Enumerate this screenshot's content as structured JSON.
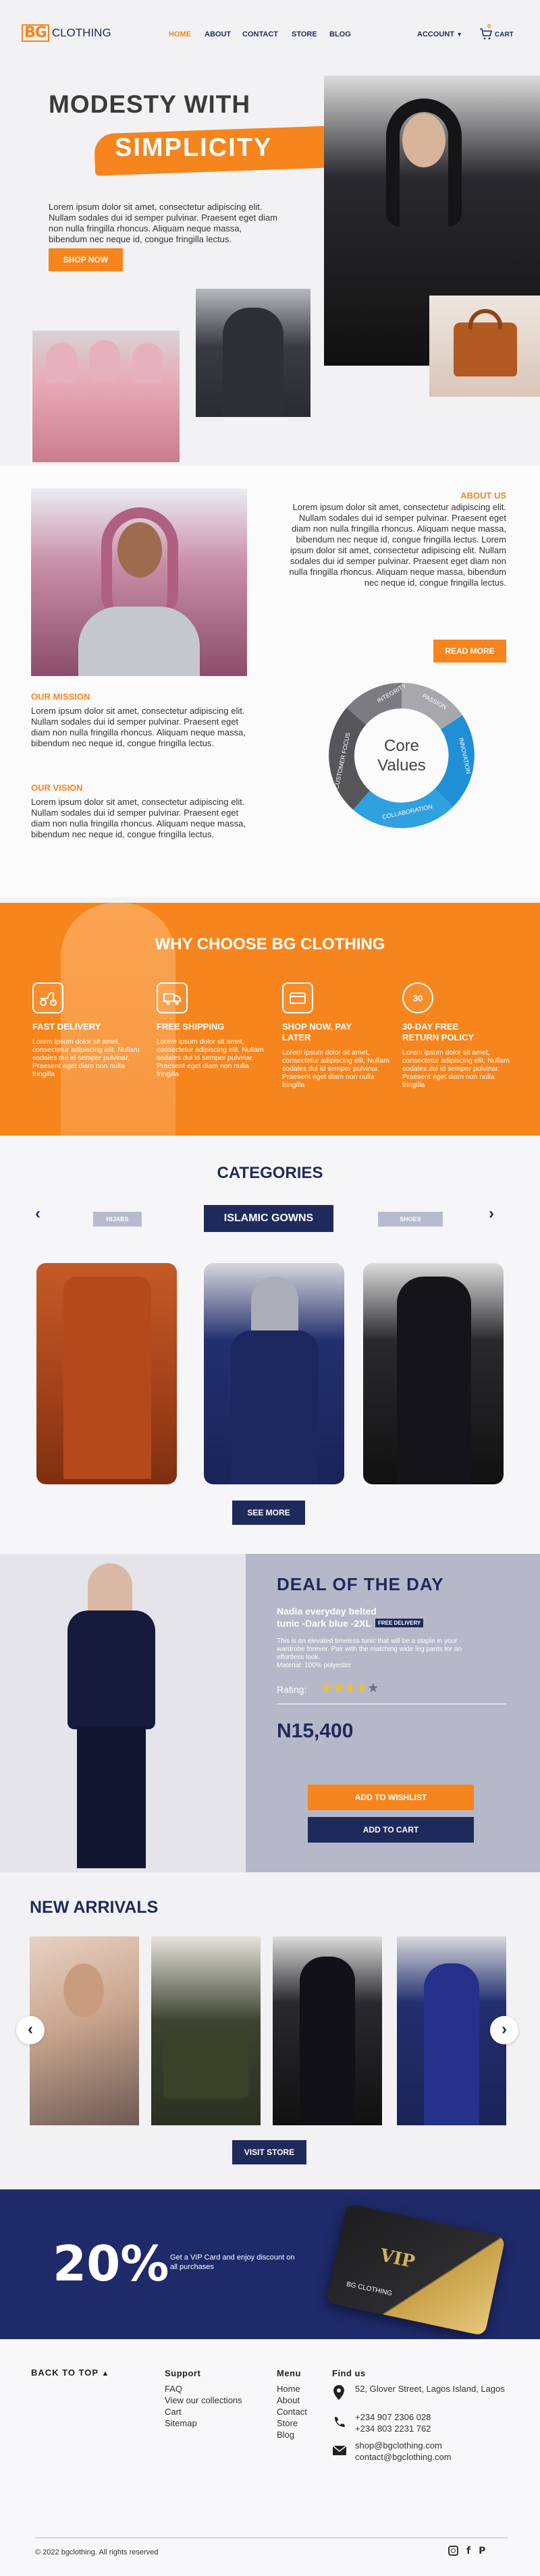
{
  "header": {
    "logo_mark": "BG",
    "logo_text": "CLOTHING",
    "nav": [
      "HOME",
      "ABOUT",
      "CONTACT",
      "STORE",
      "BLOG"
    ],
    "account": "ACCOUNT",
    "cart_count": "0",
    "cart_label": "CART",
    "colors": {
      "accent": "#f7851d",
      "brand": "#1f2a5c"
    }
  },
  "hero": {
    "title_line1": "MODESTY WITH",
    "title_line2": "SIMPLICITY",
    "text": "Lorem ipsum dolor sit amet, consectetur adipiscing elit. Nullam sodales dui id semper pulvinar. Praesent eget diam non nulla fringilla rhoncus. Aliquam neque massa, bibendum nec neque id, congue fringilla lectus.",
    "cta": "SHOP NOW"
  },
  "about": {
    "heading": "ABOUT US",
    "text": "Lorem ipsum dolor sit amet, consectetur adipiscing elit. Nullam sodales dui id semper pulvinar. Praesent eget diam non nulla fringilla rhoncus. Aliquam neque massa, bibendum nec neque id, congue fringilla lectus. Lorem ipsum dolor sit amet, consectetur adipiscing elit. Nullam sodales dui id semper pulvinar. Praesent eget diam non nulla fringilla rhoncus. Aliquam neque massa, bibendum nec neque id, congue fringilla lectus.",
    "cta": "READ MORE",
    "mission_heading": "OUR MISSION",
    "mission_text": "Lorem ipsum dolor sit amet, consectetur adipiscing elit. Nullam sodales dui id semper pulvinar. Praesent eget diam non nulla fringilla rhoncus. Aliquam neque massa, bibendum nec neque id, congue fringilla lectus.",
    "vision_heading": "OUR VISION",
    "vision_text": "Lorem ipsum dolor sit amet, consectetur adipiscing elit. Nullam sodales dui id semper pulvinar. Praesent eget diam non nulla fringilla rhoncus. Aliquam neque massa, bibendum nec neque id, congue fringilla lectus."
  },
  "core_values": {
    "center_line1": "Core",
    "center_line2": "Values",
    "segments": [
      "INTEGRITY",
      "PASSION",
      "INNOVATION",
      "COLLABORATION",
      "CUSTOMER FOCUS"
    ]
  },
  "why": {
    "heading": "WHY CHOOSE BG CLOTHING",
    "items": [
      {
        "title": "FAST DELIVERY",
        "text": "Lorem ipsum dolor sit amet, consectetur adipiscing elit. Nullam sodales dui id semper pulvinar. Praesent eget diam non nulla fringilla",
        "icon": "delivery-scooter-icon"
      },
      {
        "title": "FREE SHIPPING",
        "text": "Lorem ipsum dolor sit amet, consectetur adipiscing elit. Nullam sodales dui id semper pulvinar. Praesent eget diam non nulla fringilla",
        "icon": "truck-icon"
      },
      {
        "title": "SHOP NOW, PAY LATER",
        "text": "Lorem ipsum dolor sit amet, consectetur adipiscing elit. Nullam sodales dui id semper pulvinar. Praesent eget diam non nulla fringilla",
        "icon": "card-payment-icon"
      },
      {
        "title": "30-DAY FREE RETURN POLICY",
        "text": "Lorem ipsum dolor sit amet, consectetur adipiscing elit. Nullam sodales dui id semper pulvinar. Praesent eget diam non nulla fringilla",
        "icon": "thirty-day-return-icon"
      }
    ]
  },
  "categories": {
    "heading": "CATEGORIES",
    "tabs": [
      "HIJABS",
      "ISLAMIC GOWNS",
      "SHOES"
    ],
    "active": "ISLAMIC GOWNS",
    "cta": "SEE MORE"
  },
  "deal": {
    "heading": "DEAL OF THE DAY",
    "product": "Nadia everyday belted tunic -Dark blue -2XL",
    "badge": "FREE DELIVERY",
    "description": "This is an elevated timeless tunic that will be a staple in your wardrobe forever. Pair with the matching wide leg pants for an effortless look.",
    "material": "Material: 100% polyester",
    "rating_label": "Rating:",
    "rating": 4,
    "rating_max": 5,
    "price": "N15,400",
    "wishlist": "ADD TO WISHLIST",
    "cart": "ADD TO CART"
  },
  "arrivals": {
    "heading": "NEW ARRIVALS",
    "cta": "VISIT STORE"
  },
  "vip": {
    "percent": "20%",
    "text": "Get a VIP Card and enjoy discount on all purchases",
    "card_label": "VIP",
    "card_brand": "BG CLOTHING"
  },
  "footer": {
    "back_to_top": "BACK TO TOP",
    "support_heading": "Support",
    "support_links": [
      "FAQ",
      "View our collections",
      "Cart",
      "Sitemap"
    ],
    "menu_heading": "Menu",
    "menu_links": [
      "Home",
      "About",
      "Contact",
      "Store",
      "Blog"
    ],
    "find_heading": "Find us",
    "address": "52, Glover Street, Lagos Island, Lagos",
    "phone1": "+234 907 2306 028",
    "phone2": "+234 803 2231 762",
    "email1": "shop@bgclothing.com",
    "email2": "contact@bgclothing.com",
    "copyright": "2022 bgclothing. All rights reserved"
  }
}
